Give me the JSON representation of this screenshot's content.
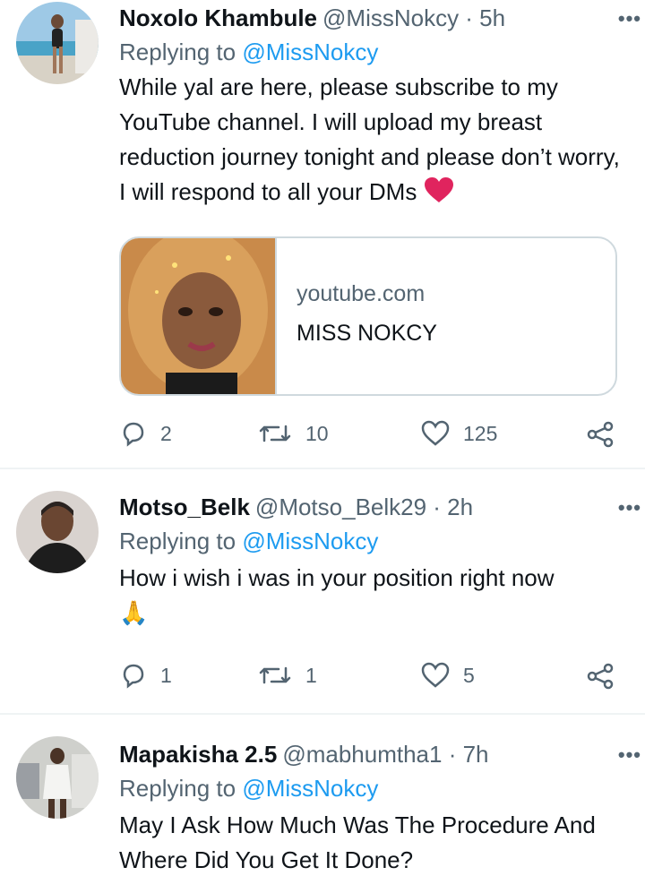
{
  "tweets": [
    {
      "name": "Noxolo Khambule",
      "handle_time": "@MissNokcy · 5h",
      "replying_prefix": "Replying to",
      "replying_to": "@MissNokcy",
      "text": "While yal are here, please subscribe to my YouTube channel. I will upload my breast reduction journey tonight and please don’t worry, I will respond to all your DMs",
      "card": {
        "domain": "youtube.com",
        "title": "MISS NOKCY"
      },
      "stats": {
        "replies": "2",
        "retweets": "10",
        "likes": "125"
      }
    },
    {
      "name": "Motso_Belk",
      "handle_time": "@Motso_Belk29 · 2h",
      "replying_prefix": "Replying to",
      "replying_to": "@MissNokcy",
      "text": "How i wish i was in your position right now",
      "emoji": "🙏",
      "stats": {
        "replies": "1",
        "retweets": "1",
        "likes": "5"
      }
    },
    {
      "name": "Mapakisha 2.5",
      "handle_time": "@mabhumtha1 · 7h",
      "replying_prefix": "Replying to",
      "replying_to": "@MissNokcy",
      "text": "May I Ask How Much Was The Procedure And Where Did You Get It Done?"
    }
  ],
  "more_label": "•••",
  "colors": {
    "link": "#1d9bf0",
    "muted": "#536471",
    "text": "#0f1419",
    "heart": "#e0245e"
  },
  "icons": [
    "reply-icon",
    "retweet-icon",
    "like-icon",
    "share-icon",
    "more-icon",
    "red-heart-emoji"
  ]
}
